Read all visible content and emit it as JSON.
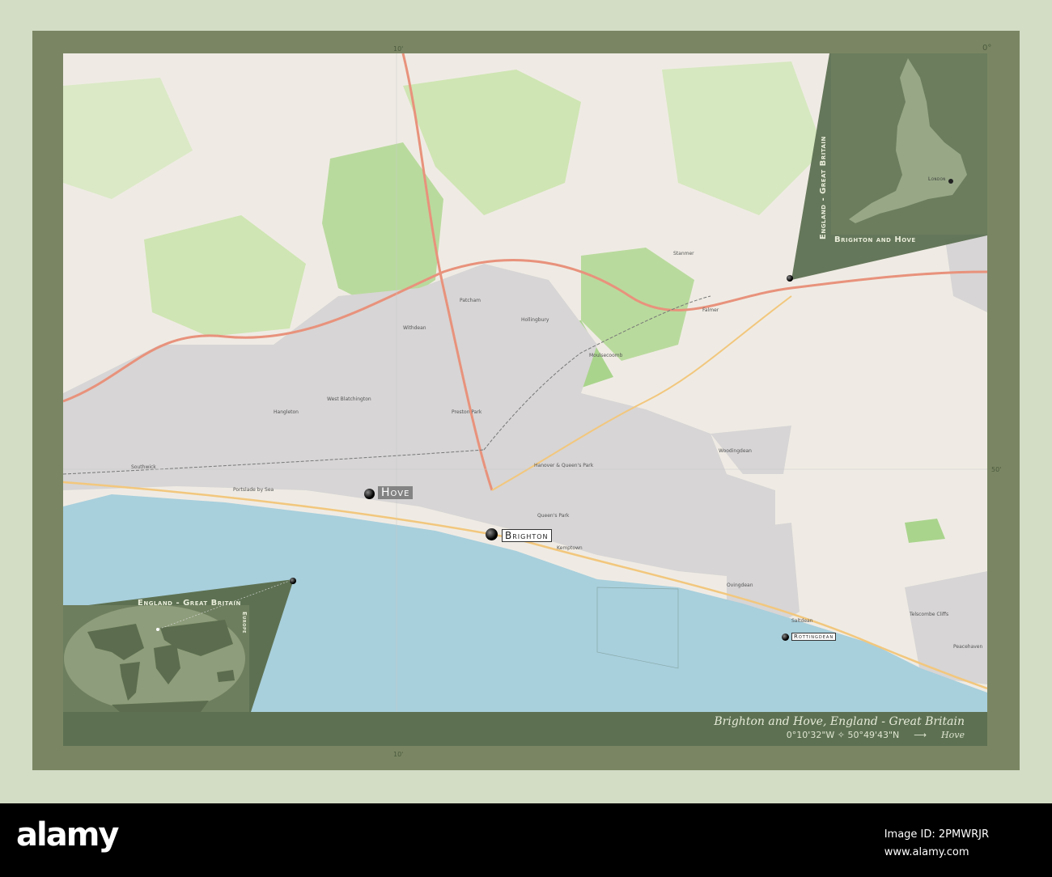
{
  "map": {
    "cities": {
      "brighton": "Brighton",
      "hove": "Hove",
      "rottingdean": "Rottingdean"
    },
    "places": [
      "Southwick",
      "Portslade by Sea",
      "West Blatchington",
      "Hangleton",
      "Patcham",
      "Hollingbury",
      "Withdean",
      "Preston Park",
      "Hanover & Queen's Park",
      "Queen's Park",
      "Kemptown",
      "Woodingdean",
      "Ovingdean",
      "Saltdean",
      "Peacehaven",
      "Stanmer",
      "Falmer",
      "Telscombe Cliffs",
      "Moulsecoomb"
    ],
    "ticks": {
      "top_left": "10'",
      "top_right": "0°",
      "right": "50'",
      "bottom": "10'"
    }
  },
  "inset_country": {
    "side_label": "England - Great Britain",
    "bottom_label": "Brighton and Hove",
    "capital": "London"
  },
  "inset_world": {
    "title": "England - Great Britain",
    "side_label": "Europe"
  },
  "caption": {
    "title": "Brighton and Hove, England - Great Britain",
    "coords": "0°10'32\"W ✧ 50°49'43\"N",
    "arrow": "⟶",
    "nearest": "Hove"
  },
  "watermark": {
    "logo": "alamy",
    "image_id": "Image ID: 2PMWRJR",
    "url": "www.alamy.com"
  },
  "colors": {
    "sea": "#a8cfdc",
    "land": "#efebe4",
    "green": "#b7d89a",
    "urban": "#d6d4d4",
    "frame": "#7a8663",
    "band": "#5d7152"
  }
}
